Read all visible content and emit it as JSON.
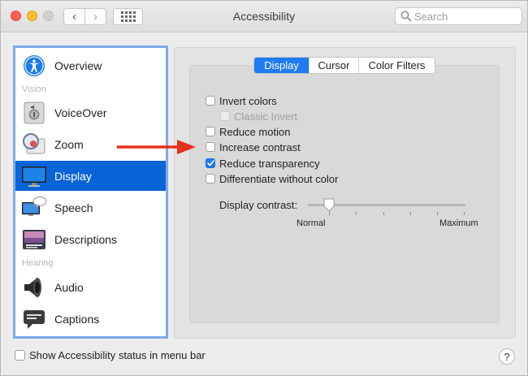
{
  "window": {
    "title": "Accessibility"
  },
  "search": {
    "placeholder": "Search"
  },
  "sidebar": {
    "items": [
      {
        "label": "Overview",
        "icon": "accessibility-person-icon"
      },
      {
        "label": "VoiceOver",
        "icon": "voiceover-icon"
      },
      {
        "label": "Zoom",
        "icon": "zoom-magnifier-icon"
      },
      {
        "label": "Display",
        "icon": "display-monitor-icon",
        "selected": true
      },
      {
        "label": "Speech",
        "icon": "speech-icon"
      },
      {
        "label": "Descriptions",
        "icon": "descriptions-icon"
      },
      {
        "label": "Audio",
        "icon": "speaker-icon"
      },
      {
        "label": "Captions",
        "icon": "captions-icon"
      }
    ],
    "sections": {
      "vision": "Vision",
      "hearing": "Hearing"
    }
  },
  "tabs": [
    {
      "label": "Display",
      "active": true
    },
    {
      "label": "Cursor",
      "active": false
    },
    {
      "label": "Color Filters",
      "active": false
    }
  ],
  "options": {
    "invert_colors": {
      "label": "Invert colors",
      "checked": false
    },
    "classic_invert": {
      "label": "Classic Invert",
      "checked": false,
      "disabled": true
    },
    "reduce_motion": {
      "label": "Reduce motion",
      "checked": false
    },
    "increase_contrast": {
      "label": "Increase contrast",
      "checked": false
    },
    "reduce_transparency": {
      "label": "Reduce transparency",
      "checked": true
    },
    "differentiate": {
      "label": "Differentiate without color",
      "checked": false
    }
  },
  "contrast": {
    "label": "Display contrast:",
    "min_label": "Normal",
    "max_label": "Maximum",
    "level": 0
  },
  "footer": {
    "status_label": "Show Accessibility status in menu bar",
    "status_checked": false,
    "help": "?"
  },
  "colors": {
    "accent": "#0a64d8",
    "arrow": "#e8311c",
    "sidebar_border": "#7fa9e8"
  }
}
